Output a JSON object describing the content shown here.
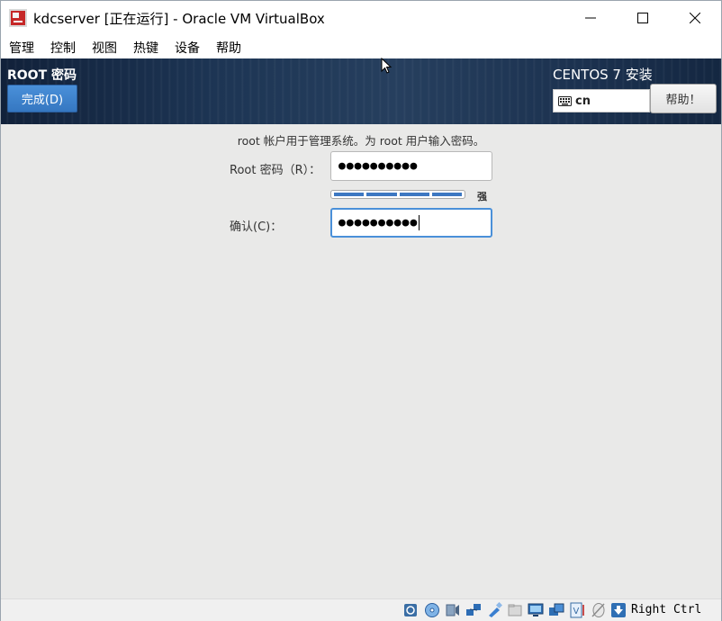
{
  "window": {
    "title": "kdcserver [正在运行] - Oracle VM VirtualBox"
  },
  "menubar": {
    "items": [
      "管理",
      "控制",
      "视图",
      "热键",
      "设备",
      "帮助"
    ]
  },
  "header": {
    "spoke_title": "ROOT 密码",
    "done_label": "完成(D)",
    "product_title": "CENTOS 7 安装",
    "keyboard_layout": "cn",
    "help_label": "帮助！"
  },
  "form": {
    "intro": "root 帐户用于管理系统。为 root 用户输入密码。",
    "root_password_label": "Root 密码（R）：",
    "root_password_value": "●●●●●●●●●●",
    "strength_label": "强",
    "strength_fraction": 1.0,
    "confirm_label": "确认(C)：",
    "confirm_value": "●●●●●●●●●●"
  },
  "statusbar": {
    "host_key": "Right Ctrl",
    "icons": [
      "hard-disk-icon",
      "optical-disk-icon",
      "audio-icon",
      "network-icon",
      "usb-icon",
      "shared-folders-icon",
      "display-icon",
      "video-capture-icon",
      "virtualization-icon",
      "mouse-integration-icon",
      "host-key-arrow-icon"
    ]
  },
  "colors": {
    "accent": "#4a90d9",
    "header_bg": "#1d3554",
    "content_bg": "#e9e9e8"
  }
}
